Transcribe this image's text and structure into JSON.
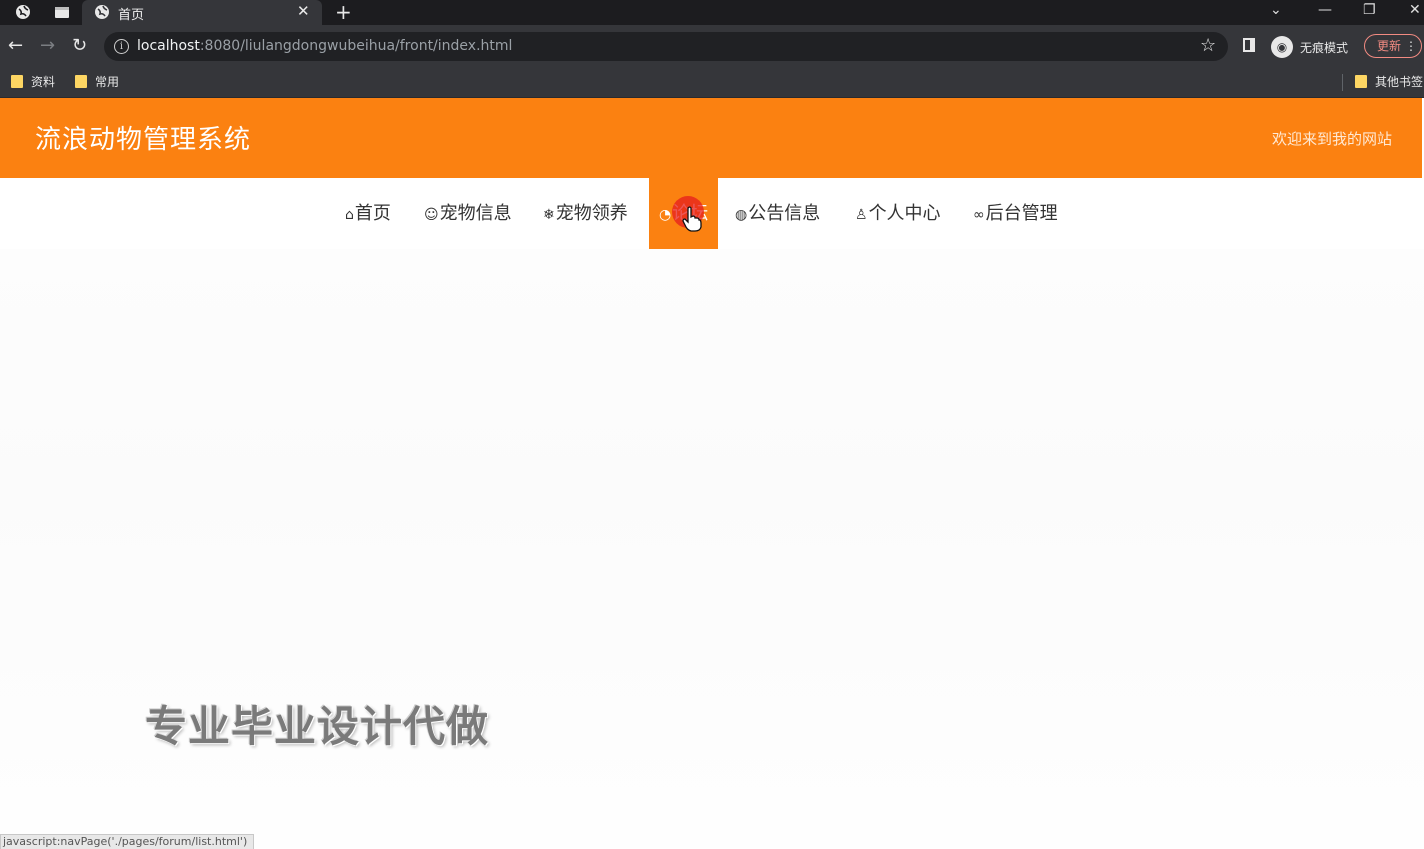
{
  "browser": {
    "tab_title": "首页",
    "url_host": "localhost",
    "url_rest": ":8080/liulangdongwubeihua/front/index.html",
    "incognito_label": "无痕模式",
    "update_label": "更新",
    "bookmarks": [
      "资料",
      "常用"
    ],
    "other_bookmarks": "其他书签",
    "status_text": "javascript:navPage('./pages/forum/list.html')"
  },
  "site": {
    "title": "流浪动物管理系统",
    "welcome": "欢迎来到我的网站",
    "accent_color": "#fb8111",
    "menu": [
      {
        "label": "首页",
        "icon": "home-icon"
      },
      {
        "label": "宠物信息",
        "icon": "paw-icon"
      },
      {
        "label": "宠物领养",
        "icon": "snowflake-icon"
      },
      {
        "label": "论坛",
        "icon": "dashboard-icon",
        "active": true
      },
      {
        "label": "公告信息",
        "icon": "globe-icon"
      },
      {
        "label": "个人中心",
        "icon": "user-icon"
      },
      {
        "label": "后台管理",
        "icon": "link-icon"
      }
    ]
  },
  "watermark": "专业毕业设计代做"
}
